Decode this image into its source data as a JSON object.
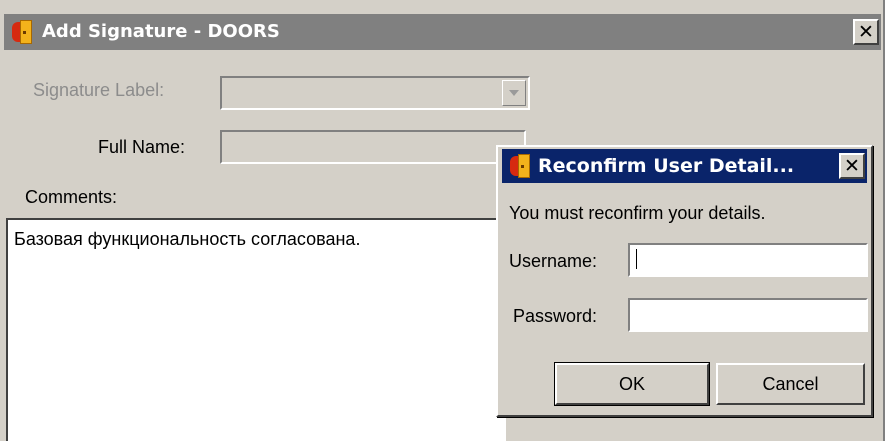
{
  "main_dialog": {
    "title": "Add Signature - DOORS",
    "close_glyph": "✕",
    "signature_label": {
      "label": "Signature Label:",
      "value": ""
    },
    "full_name": {
      "label": "Full Name:",
      "value": ""
    },
    "comments": {
      "label": "Comments:",
      "value": "Базовая функциональность согласована."
    }
  },
  "reconfirm_dialog": {
    "title": "Reconfirm User Detail...",
    "close_glyph": "✕",
    "message": "You must reconfirm your details.",
    "username": {
      "label": "Username:",
      "value": ""
    },
    "password": {
      "label": "Password:",
      "value": ""
    },
    "ok_label": "OK",
    "cancel_label": "Cancel"
  },
  "icons": {
    "app": "doors-app-icon",
    "combo": "chevron-down-icon",
    "close": "close-icon"
  },
  "colors": {
    "active_title": "#0a246a",
    "inactive_title": "#808080",
    "face": "#d4d0c8"
  }
}
